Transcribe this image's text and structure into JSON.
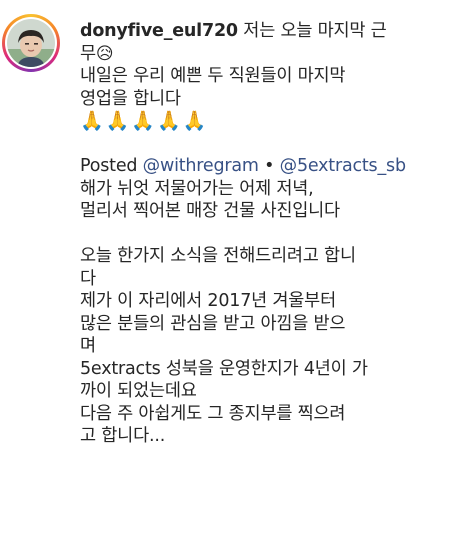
{
  "post": {
    "username": "donyfive_eul720",
    "line1_text": "저는 오늘 마지막 근",
    "line2_text": "무",
    "sad_emoji": "😥",
    "line3": "내일은 우리 예쁜 두 직원들이 마지막",
    "line4": "영업을 합니다",
    "prayers": "🙏🙏🙏🙏🙏",
    "posted_label": "Posted",
    "mention1": "@withregram",
    "bullet": "•",
    "mention2": "@5extracts_sb",
    "body": [
      "해가 뉘엇 저물어가는 어제 저녁,",
      "멀리서 찍어본 매장 건물 사진입니다",
      "",
      "오늘 한가지 소식을 전해드리려고 합니",
      "다",
      "제가 이 자리에서 2017년 겨울부터",
      "많은 분들의 관심을 받고 아낌을 받으",
      "며",
      "5extracts 성북을 운영한지가 4년이 가",
      "까이 되었는데요",
      "다음 주 아쉽게도 그 종지부를 찍으려",
      "고 합니다..."
    ]
  },
  "colors": {
    "text": "#262626",
    "link": "#385185",
    "ring_gradient": [
      "#f9c230",
      "#f58529",
      "#dd2a7b",
      "#8134af"
    ]
  },
  "icons": {
    "avatar": "profile-avatar"
  }
}
